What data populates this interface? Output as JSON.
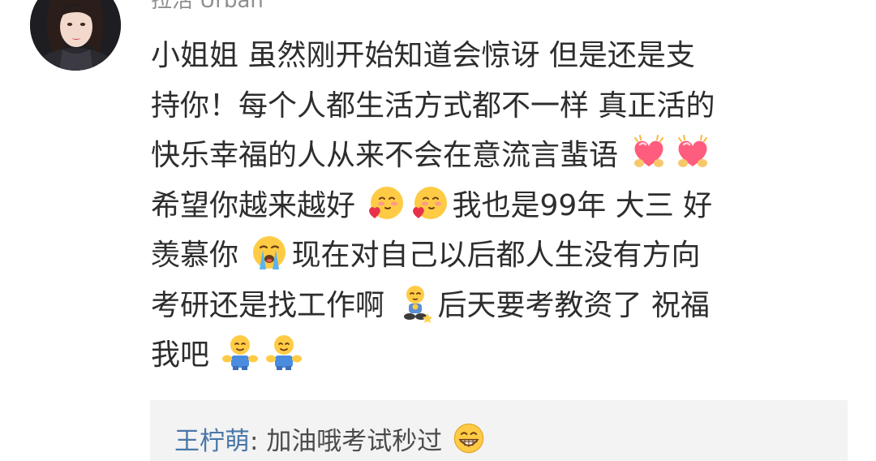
{
  "comment": {
    "username": "拉活 Urban",
    "lines": [
      {
        "segments": [
          {
            "text": "小姐姐 虽然刚开始知道会惊讶 但是还是支"
          }
        ]
      },
      {
        "segments": [
          {
            "text": "持你！每个人都生活方式都不一样 真正活的"
          }
        ]
      },
      {
        "segments": [
          {
            "text": "快乐幸福的人从来不会在意流言蜚语 "
          },
          {
            "icon": "heart-hands-emoji"
          },
          {
            "icon": "heart-hands-emoji"
          }
        ]
      },
      {
        "segments": [
          {
            "text": "希望你越来越好 "
          },
          {
            "icon": "blushing-heart-emoji"
          },
          {
            "icon": "blushing-heart-emoji"
          },
          {
            "text": "我也是99年 大三 好"
          }
        ]
      },
      {
        "segments": [
          {
            "text": "羡慕你 "
          },
          {
            "icon": "crying-face-emoji"
          },
          {
            "text": "现在对自己以后都人生没有方向"
          }
        ]
      },
      {
        "segments": [
          {
            "text": "考研还是找工作啊 "
          },
          {
            "icon": "squatting-thinking-emoji"
          },
          {
            "text": "后天要考教资了 祝福"
          }
        ]
      },
      {
        "segments": [
          {
            "text": "我吧 "
          },
          {
            "icon": "hugging-figure-emoji"
          },
          {
            "icon": "hugging-figure-emoji"
          }
        ]
      }
    ]
  },
  "reply": {
    "author": "王柠萌",
    "separator": ": ",
    "text": "加油哦考试秒过 ",
    "icon": "grinning-emoji"
  },
  "colors": {
    "reply_author": "#4a78a8",
    "reply_background": "#f3f3f3",
    "text": "#2d2d2d",
    "username": "#8f8f8f"
  }
}
